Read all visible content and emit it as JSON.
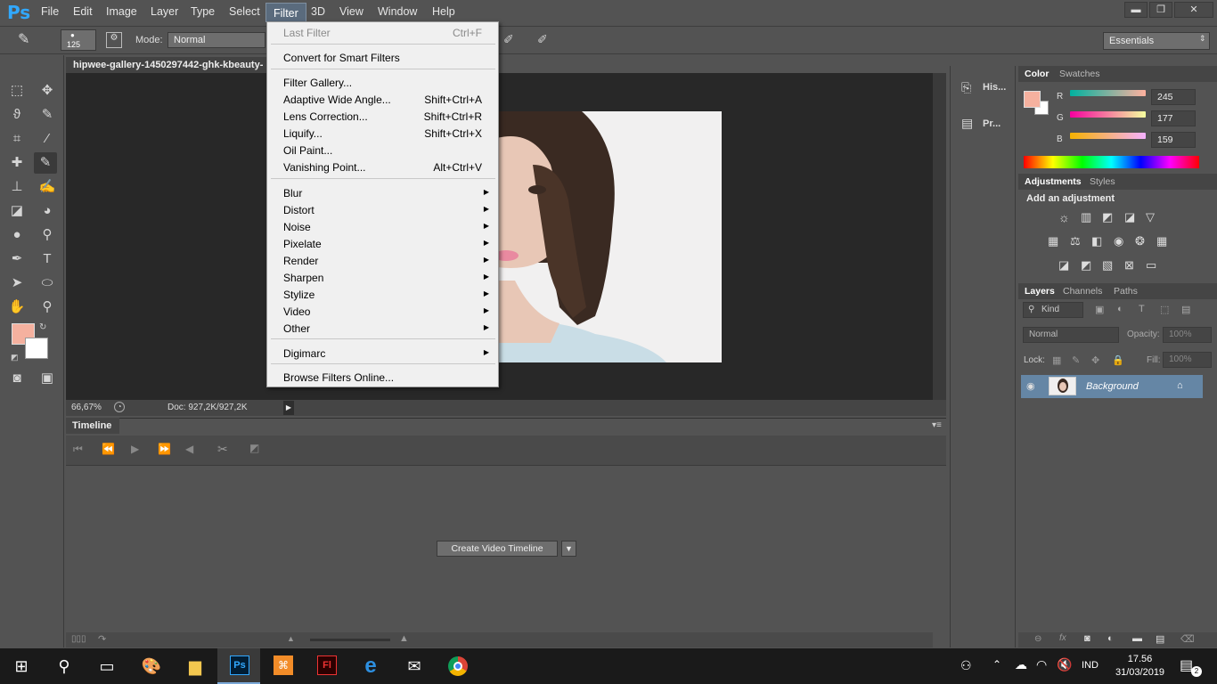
{
  "app": {
    "logo": "Ps"
  },
  "menubar": {
    "items": [
      "File",
      "Edit",
      "Image",
      "Layer",
      "Type",
      "Select",
      "Filter",
      "3D",
      "View",
      "Window",
      "Help"
    ],
    "active": "Filter"
  },
  "window_controls": {
    "minimize": "▬",
    "restore": "❐",
    "close": "✕"
  },
  "options_bar": {
    "brush_size": "125",
    "mode_label": "Mode:",
    "mode_value": "Normal",
    "workspace": "Essentials"
  },
  "document": {
    "tab_title": "hipwee-gallery-1450297442-ghk-kbeauty-",
    "zoom": "66,67%",
    "doc_size": "Doc: 927,2K/927,2K"
  },
  "timeline": {
    "tab_label": "Timeline",
    "create_button": "Create Video Timeline"
  },
  "mid_panel": {
    "history_label": "His...",
    "properties_label": "Pr..."
  },
  "color_panel": {
    "tabs": [
      "Color",
      "Swatches"
    ],
    "r_label": "R",
    "r_value": "245",
    "g_label": "G",
    "g_value": "177",
    "b_label": "B",
    "b_value": "159",
    "foreground": "#f5b19f"
  },
  "adjustments_panel": {
    "tabs": [
      "Adjustments",
      "Styles"
    ],
    "heading": "Add an adjustment"
  },
  "layers_panel": {
    "tabs": [
      "Layers",
      "Channels",
      "Paths"
    ],
    "kind": "Kind",
    "blend_mode": "Normal",
    "opacity_label": "Opacity:",
    "opacity_value": "100%",
    "lock_label": "Lock:",
    "fill_label": "Fill:",
    "fill_value": "100%",
    "layer_name": "Background"
  },
  "filter_menu": {
    "last_filter": "Last Filter",
    "last_filter_shortcut": "Ctrl+F",
    "convert_smart": "Convert for Smart Filters",
    "filter_gallery": "Filter Gallery...",
    "adaptive_wide": "Adaptive Wide Angle...",
    "adaptive_wide_shortcut": "Shift+Ctrl+A",
    "lens_correction": "Lens Correction...",
    "lens_correction_shortcut": "Shift+Ctrl+R",
    "liquify": "Liquify...",
    "liquify_shortcut": "Shift+Ctrl+X",
    "oil_paint": "Oil Paint...",
    "vanishing_point": "Vanishing Point...",
    "vanishing_point_shortcut": "Alt+Ctrl+V",
    "submenus": [
      "Blur",
      "Distort",
      "Noise",
      "Pixelate",
      "Render",
      "Sharpen",
      "Stylize",
      "Video",
      "Other"
    ],
    "digimarc": "Digimarc",
    "browse_online": "Browse Filters Online..."
  },
  "taskbar": {
    "time": "17.56",
    "date": "31/03/2019",
    "language": "IND",
    "notification_count": "2"
  }
}
